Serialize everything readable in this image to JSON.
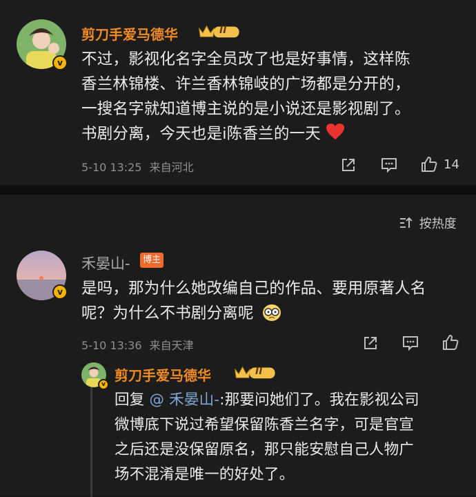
{
  "comment1": {
    "username": "剪刀手爱马德华",
    "level_badge": "II",
    "lines": [
      "不过，影视化名字全员改了也是好事情，这样陈",
      "香兰林锦楼、许兰香林锦岐的广场都是分开的，",
      "一搜名字就知道博主说的是小说还是影视剧了。",
      "书剧分离，今天也是i陈香兰的一天"
    ],
    "timestamp": "5-10 13:25",
    "location": "来自河北",
    "like_count": "14",
    "icons": [
      "share-icon",
      "comment-icon",
      "like-icon",
      "heart-emoji-icon",
      "crown-icon",
      "verified-icon"
    ]
  },
  "sort": {
    "label": "按热度",
    "icon": "sort-icon"
  },
  "comment2": {
    "username": "禾晏山-",
    "role_tag": "博主",
    "lines": [
      "是吗，那为什么她改编自己的作品、要用原著人名",
      "呢？为什么不书剧分离呢"
    ],
    "timestamp": "5-10 13:36",
    "location": "来自天津",
    "icons": [
      "share-icon",
      "comment-icon",
      "like-icon",
      "emoji-icon",
      "verified-icon"
    ]
  },
  "reply": {
    "username": "剪刀手爱马德华",
    "level_badge": "II",
    "prefix": "回复",
    "mention": "@ 禾晏山-",
    "lines": [
      ":那要问她们了。我在影视公司",
      "微博底下说过希望保留陈香兰名字，可是官宣",
      "之后还是没保留原名，那只能安慰自己人物广",
      "场不混淆是唯一的好处了。"
    ]
  }
}
